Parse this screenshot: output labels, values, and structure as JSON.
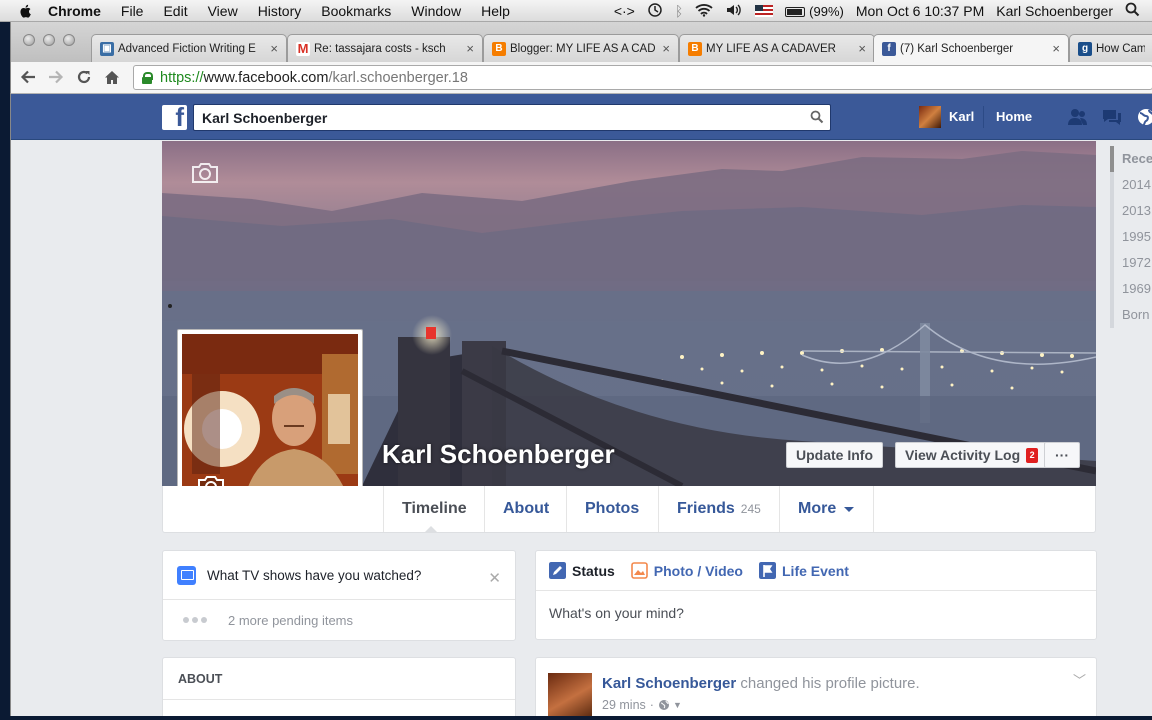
{
  "menubar": {
    "items": [
      "Chrome",
      "File",
      "Edit",
      "View",
      "History",
      "Bookmarks",
      "Window",
      "Help"
    ],
    "battery": "(99%)",
    "clock": "Mon Oct 6  10:37 PM",
    "user": "Karl Schoenberger"
  },
  "browser": {
    "tabs": [
      {
        "title": "Advanced Fiction Writing E",
        "favicon_color": "#3a6ea5"
      },
      {
        "title": "Re: tassajara costs - ksch",
        "favicon_color": "#d93025"
      },
      {
        "title": "Blogger: MY LIFE AS A CAD",
        "favicon_color": "#f57d00"
      },
      {
        "title": "MY LIFE AS A CADAVER",
        "favicon_color": "#f57d00"
      },
      {
        "title": "(7) Karl Schoenberger",
        "favicon_color": "#3b5998"
      },
      {
        "title": "How Cambr",
        "favicon_color": "#1a4e8a"
      }
    ],
    "url": {
      "scheme": "https://",
      "host": "www.facebook.com",
      "path": "/karl.schoenberger.18"
    }
  },
  "facebook": {
    "search_value": "Karl Schoenberger",
    "nav_user": "Karl",
    "nav_home": "Home",
    "profile_name": "Karl Schoenberger",
    "update_info": "Update Info",
    "activity_log": "View Activity Log",
    "activity_badge": "2",
    "more_dots": "···",
    "timeline_tabs": [
      "Timeline",
      "About",
      "Photos",
      "Friends",
      "More"
    ],
    "friends_count": "245",
    "years": [
      "Rece",
      "2014",
      "2013",
      "1995",
      "1972",
      "1969",
      "Born"
    ],
    "tv_prompt": "What TV shows have you watched?",
    "pending": "2 more pending items",
    "about_header": "ABOUT",
    "composer_tabs": [
      "Status",
      "Photo / Video",
      "Life Event"
    ],
    "composer_placeholder": "What's on your mind?",
    "story_author": "Karl Schoenberger",
    "story_action": "changed his profile picture.",
    "story_time": "29 mins"
  }
}
